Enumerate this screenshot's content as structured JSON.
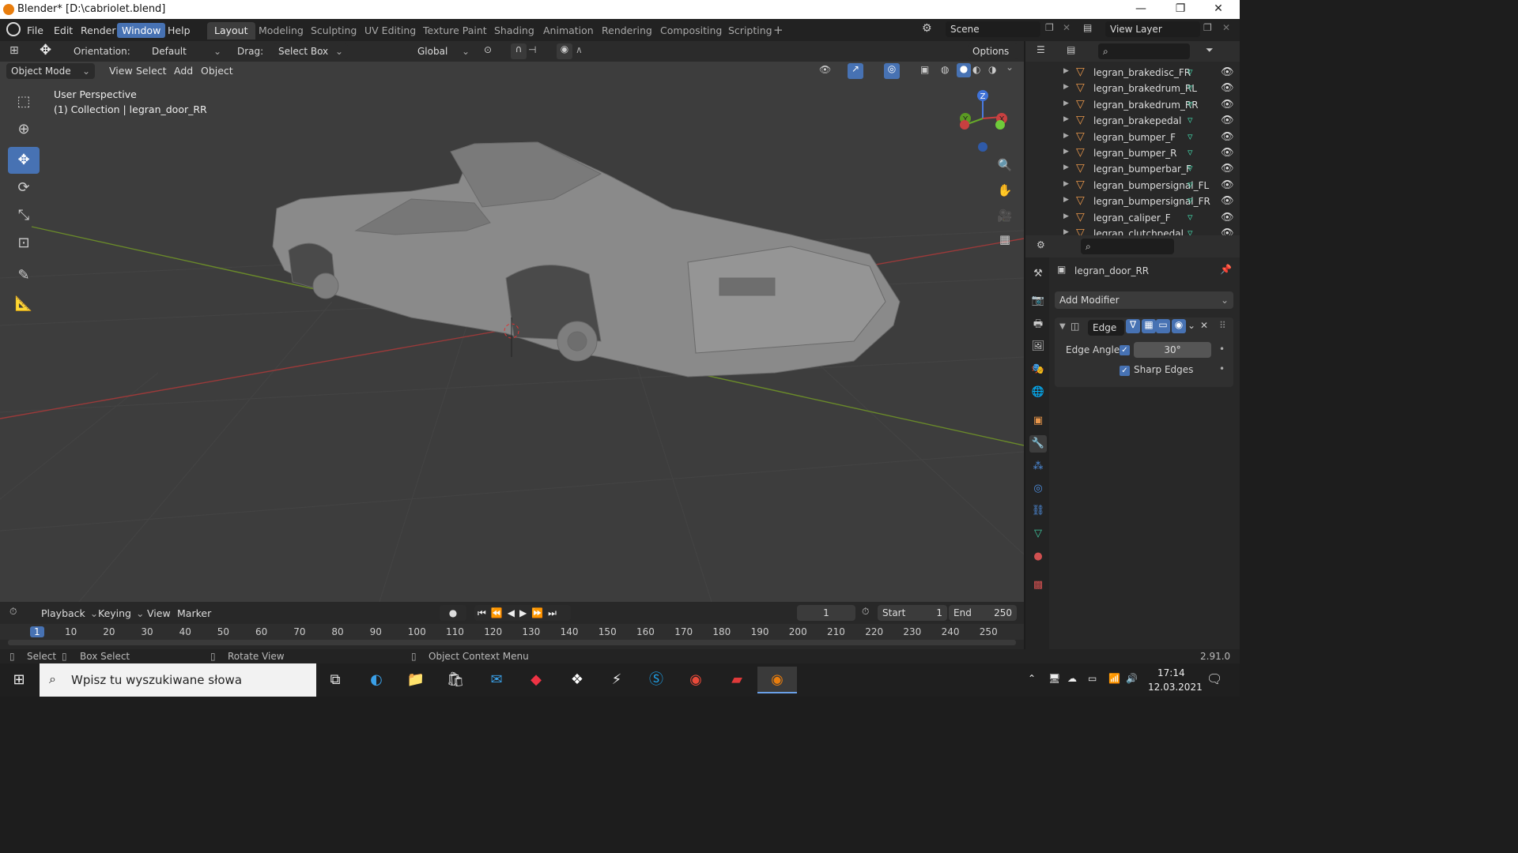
{
  "window": {
    "title": "Blender* [D:\\cabriolet.blend]",
    "minimize": "—",
    "maximize": "❐",
    "close": "✕"
  },
  "menu": [
    "File",
    "Edit",
    "Render",
    "Window",
    "Help"
  ],
  "active_menu": "Window",
  "workspaces": [
    "Layout",
    "Modeling",
    "Sculpting",
    "UV Editing",
    "Texture Paint",
    "Shading",
    "Animation",
    "Rendering",
    "Compositing",
    "Scripting"
  ],
  "active_workspace": "Layout",
  "scene_label": "Scene",
  "view_layer_label": "View Layer",
  "viewport_header": {
    "orientation_label": "Orientation:",
    "orientation_value": "Default",
    "drag_label": "Drag:",
    "drag_value": "Select Box",
    "transform_orientation": "Global",
    "options": "Options"
  },
  "viewport_header2": {
    "mode": "Object Mode",
    "items": [
      "View",
      "Select",
      "Add",
      "Object"
    ]
  },
  "viewport_overlay": {
    "perspective": "User Perspective",
    "collection": "(1) Collection | legran_door_RR"
  },
  "gizmo": {
    "z": "Z",
    "y": "Y",
    "x": "X"
  },
  "outliner_items": [
    "legran_brakedisc_FR",
    "legran_brakedrum_RL",
    "legran_brakedrum_RR",
    "legran_brakepedal",
    "legran_bumper_F",
    "legran_bumper_R",
    "legran_bumperbar_F",
    "legran_bumpersignal_FL",
    "legran_bumpersignal_FR",
    "legran_caliper_F",
    "legran_clutchpedal"
  ],
  "properties": {
    "object_name": "legran_door_RR",
    "add_modifier": "Add Modifier",
    "modifier_name": "Edge",
    "edge_angle_label": "Edge Angle",
    "edge_angle_value": "30°",
    "sharp_edges_label": "Sharp Edges"
  },
  "timeline": {
    "menus": [
      "Playback",
      "Keying",
      "View",
      "Marker"
    ],
    "current_frame": "1",
    "start_label": "Start",
    "start_value": "1",
    "end_label": "End",
    "end_value": "250",
    "ruler": [
      "1",
      "10",
      "20",
      "30",
      "40",
      "50",
      "60",
      "70",
      "80",
      "90",
      "100",
      "110",
      "120",
      "130",
      "140",
      "150",
      "160",
      "170",
      "180",
      "190",
      "200",
      "210",
      "220",
      "230",
      "240",
      "250"
    ]
  },
  "statusbar": {
    "select": "Select",
    "box_select": "Box Select",
    "rotate_view": "Rotate View",
    "context_menu": "Object Context Menu",
    "version": "2.91.0"
  },
  "taskbar": {
    "search_placeholder": "Wpisz tu wyszukiwane słowa",
    "time": "17:14",
    "date": "12.03.2021"
  }
}
